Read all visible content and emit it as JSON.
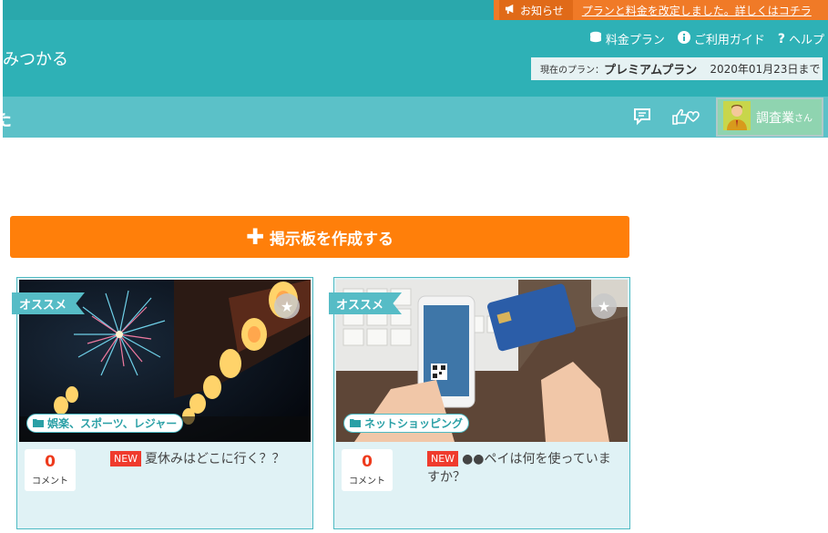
{
  "notice": {
    "tag": "お知らせ",
    "text": "プランと料金を改定しました。詳しくはコチラ"
  },
  "header": {
    "tagline": "みつかる",
    "nav": [
      {
        "icon": "coins-icon",
        "label": "料金プラン"
      },
      {
        "icon": "info-icon",
        "label": "ご利用ガイド"
      },
      {
        "icon": "question-icon",
        "label": "ヘルプ"
      }
    ],
    "plan": {
      "label": "現在のプラン：",
      "name": "プレミアムプラン",
      "expiry": "2020年01月23日まで"
    },
    "subnav_edge_text": "た",
    "user": {
      "name": "調査業",
      "suffix": "さん"
    }
  },
  "create_button": {
    "label": "掲示板を作成する"
  },
  "cards": [
    {
      "badge": "オススメ",
      "category": "娯楽、スポーツ、レジャー",
      "comments": "0",
      "comment_label": "コメント",
      "new_label": "NEW",
      "title": "夏休みはどこに行く？？"
    },
    {
      "badge": "オススメ",
      "category": "ネットショッピング",
      "comments": "0",
      "comment_label": "コメント",
      "new_label": "NEW",
      "title": "●●ペイは何を使っていますか？"
    }
  ],
  "colors": {
    "header_teal": "#2eb1b6",
    "subnav_teal": "#5bc1c8",
    "accent_orange": "#ff7f0a",
    "notice_orange": "#f07a27",
    "new_red": "#ef3b2d"
  }
}
